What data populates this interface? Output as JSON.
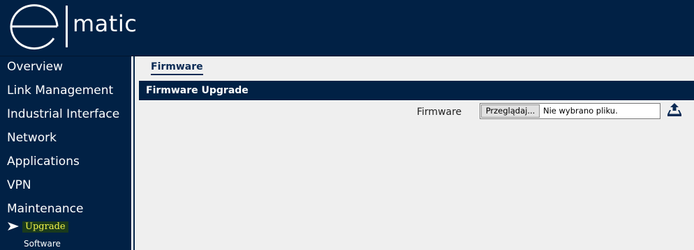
{
  "brand": {
    "logo_letter": "e",
    "logo_text": "matic"
  },
  "sidebar": {
    "items": [
      {
        "label": "Overview"
      },
      {
        "label": "Link Management"
      },
      {
        "label": "Industrial Interface"
      },
      {
        "label": "Network"
      },
      {
        "label": "Applications"
      },
      {
        "label": "VPN"
      },
      {
        "label": "Maintenance"
      }
    ],
    "sub_items": [
      {
        "label": "Upgrade",
        "active": true
      },
      {
        "label": "Software",
        "active": false
      }
    ]
  },
  "page": {
    "tab_label": "Firmware",
    "section_title": "Firmware Upgrade",
    "firmware_field": {
      "label": "Firmware",
      "browse_label": "Przeglądaj...",
      "status_text": "Nie wybrano pliku."
    },
    "upload_icon": "upload-icon"
  },
  "colors": {
    "navy": "#012145",
    "content_bg": "#efefef",
    "active_sub_text": "#f3f34a",
    "active_sub_bg": "#1a3a1c"
  }
}
